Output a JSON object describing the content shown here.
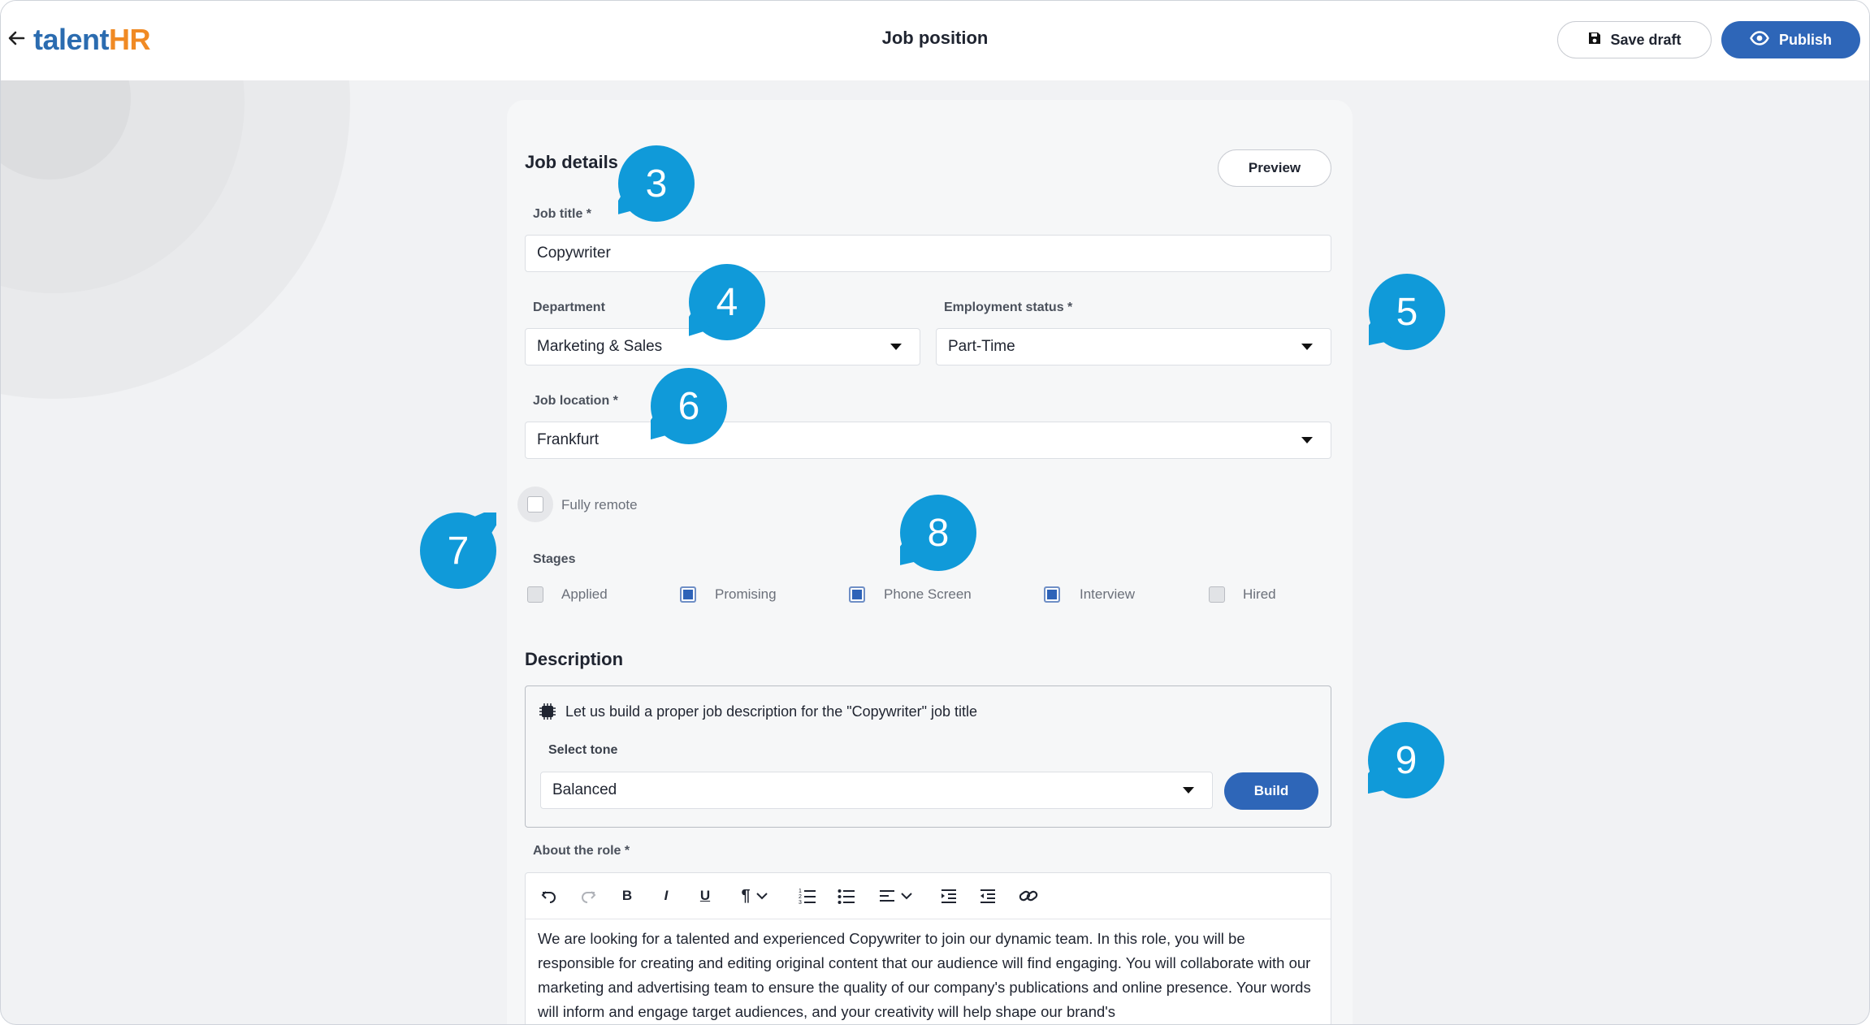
{
  "header": {
    "back_icon": "arrow-left-icon",
    "logo_part1": "talent",
    "logo_part2": "HR",
    "title": "Job position",
    "save_draft_label": "Save draft",
    "publish_label": "Publish"
  },
  "job_details": {
    "heading": "Job details",
    "preview_label": "Preview",
    "job_title_label": "Job title *",
    "job_title_value": "Copywriter",
    "department_label": "Department",
    "department_value": "Marketing & Sales",
    "employment_label": "Employment status *",
    "employment_value": "Part-Time",
    "location_label": "Job location *",
    "location_value": "Frankfurt",
    "fully_remote_label": "Fully remote",
    "stages_label": "Stages",
    "stages": [
      {
        "label": "Applied",
        "checked": false
      },
      {
        "label": "Promising",
        "checked": true
      },
      {
        "label": "Phone Screen",
        "checked": true
      },
      {
        "label": "Interview",
        "checked": true
      },
      {
        "label": "Hired",
        "checked": false
      }
    ]
  },
  "description": {
    "heading": "Description",
    "ai_text": "Let us build a proper job description for the \"Copywriter\" job title",
    "tone_label": "Select tone",
    "tone_value": "Balanced",
    "build_label": "Build",
    "about_label": "About the role *",
    "about_text": "We are looking for a talented and experienced Copywriter to join our dynamic team. In this role, you will be responsible for creating and editing original content that our audience will find engaging. You will collaborate with our marketing and advertising team to ensure the quality of our company's publications and online presence. Your words will inform and engage target audiences, and your creativity will help shape our brand's"
  },
  "callouts": [
    "3",
    "4",
    "5",
    "6",
    "7",
    "8",
    "9"
  ],
  "colors": {
    "primary": "#2e66b8",
    "callout": "#109ad9",
    "logo_blue": "#2b6cb0",
    "logo_orange": "#f08a24"
  }
}
